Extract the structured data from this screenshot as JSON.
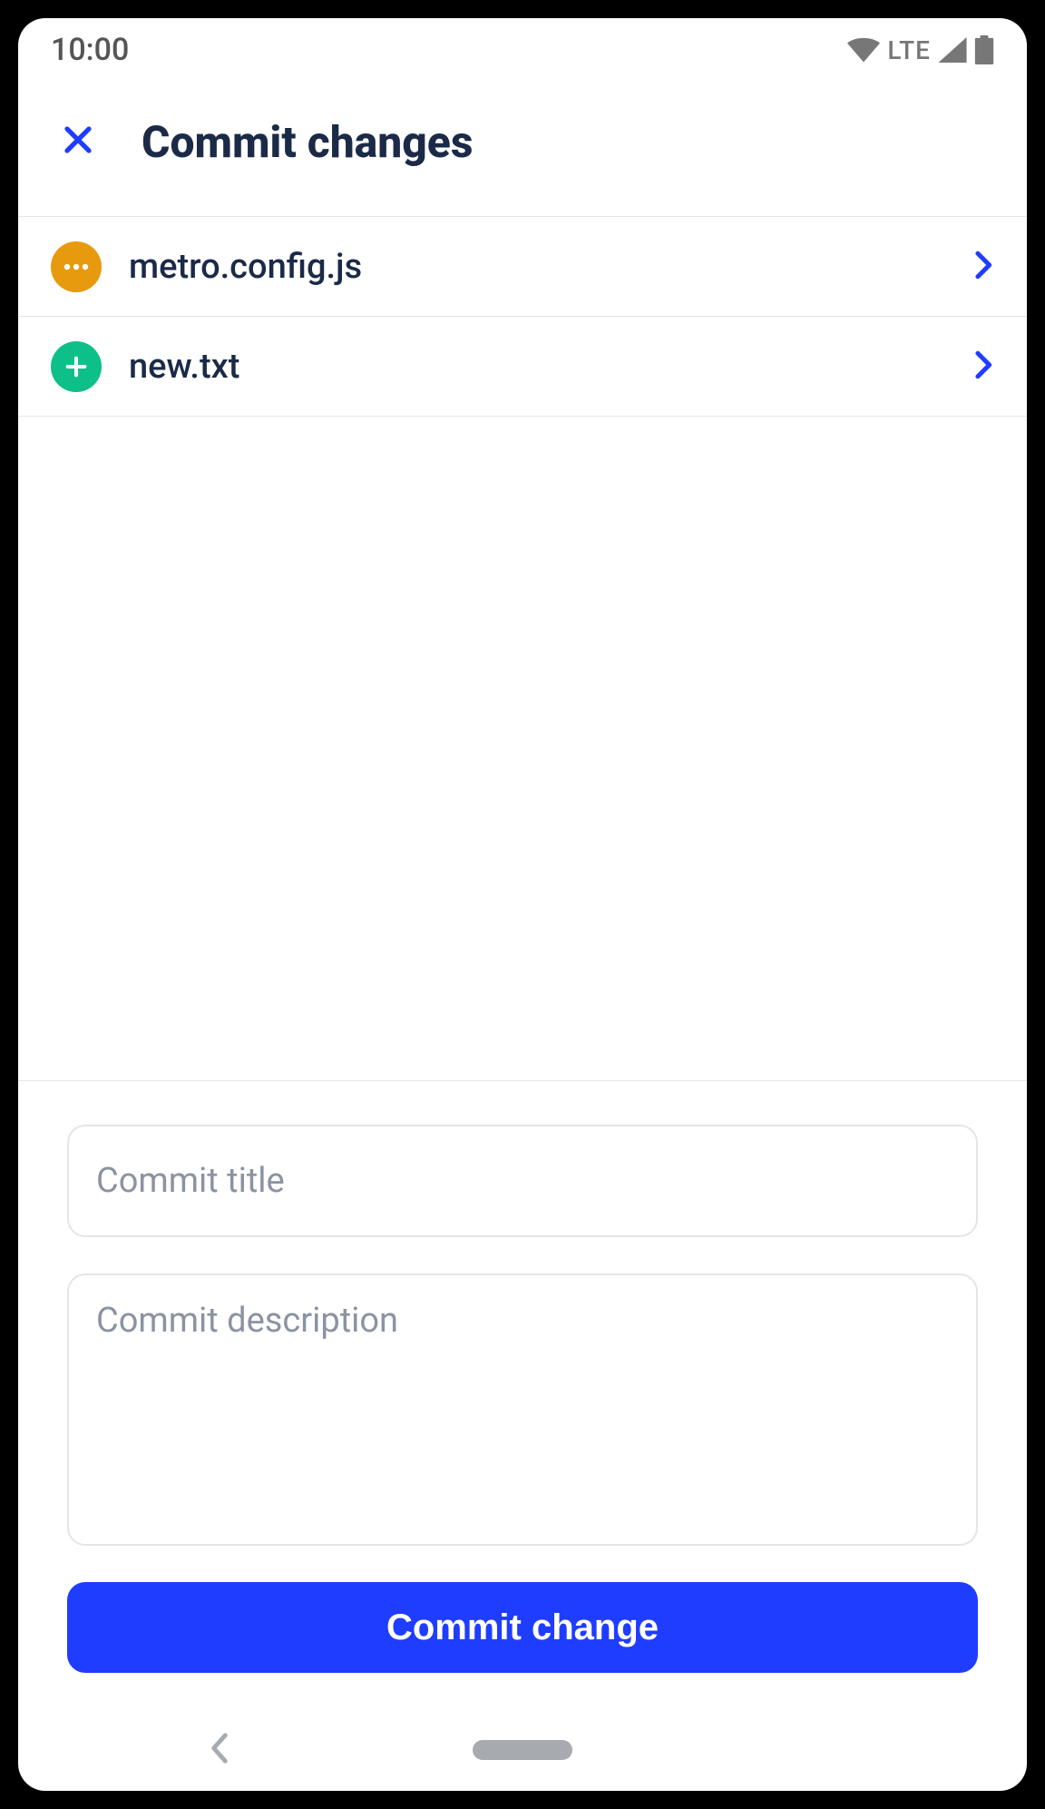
{
  "statusbar": {
    "time": "10:00",
    "network_label": "LTE"
  },
  "header": {
    "title": "Commit changes"
  },
  "files": [
    {
      "status": "modified",
      "name": "metro.config.js"
    },
    {
      "status": "added",
      "name": "new.txt"
    }
  ],
  "form": {
    "title_placeholder": "Commit title",
    "description_placeholder": "Commit description",
    "submit_label": "Commit change"
  }
}
